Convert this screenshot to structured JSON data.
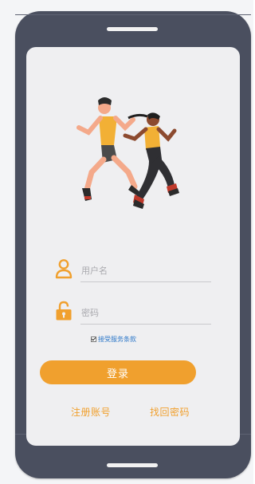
{
  "form": {
    "username_placeholder": "用户名",
    "password_placeholder": "密码",
    "terms_label": "接受服务条款",
    "terms_checked": true,
    "login_label": "登录",
    "register_label": "注册账号",
    "recover_label": "找回密码"
  },
  "colors": {
    "accent": "#f0a02e",
    "phone_frame": "#4a4f5f",
    "screen": "#efeff1",
    "link_blue": "#2e78c9"
  },
  "icons": {
    "username": "user-icon",
    "password": "lock-icon",
    "hero": "runners-illustration"
  }
}
